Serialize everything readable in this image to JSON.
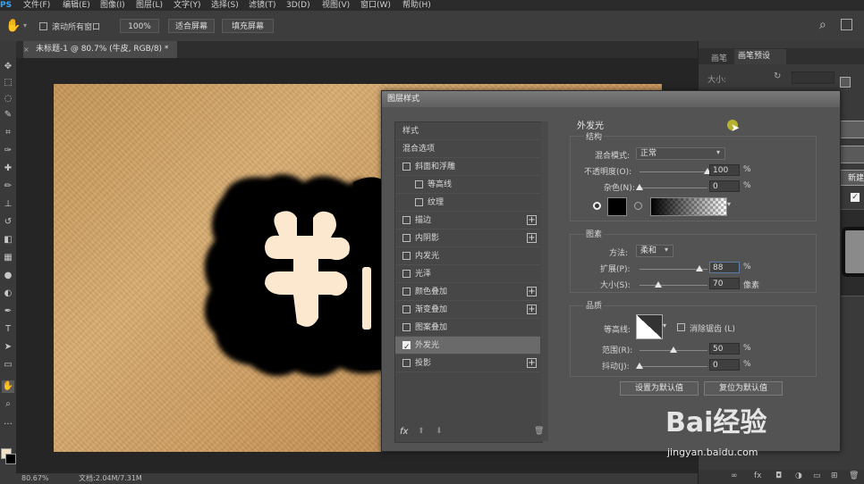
{
  "menu": {
    "app_badge": "PS",
    "items": [
      "文件(F)",
      "编辑(E)",
      "图像(I)",
      "图层(L)",
      "文字(Y)",
      "选择(S)",
      "滤镜(T)",
      "3D(D)",
      "视图(V)",
      "窗口(W)",
      "帮助(H)"
    ]
  },
  "options": {
    "scroll_all": "滚动所有窗口",
    "zoom": "100%",
    "fit_screen": "适合屏幕",
    "fill_screen": "填充屏幕"
  },
  "document": {
    "tab_title": "未标题-1 @ 80.7% (牛皮, RGB/8) *",
    "canvas_text": "朱"
  },
  "status": {
    "zoom": "80.67%",
    "doc_info": "文档:2.04M/7.31M"
  },
  "right_panel": {
    "tab1": "画笔",
    "tab2": "画笔预设",
    "size_label": "大小:"
  },
  "dialog": {
    "title": "图层样式",
    "side_items": [
      {
        "label": "样式",
        "cb": "none",
        "plus": false,
        "sel": false
      },
      {
        "label": "混合选项",
        "cb": "none",
        "plus": false,
        "sel": false
      },
      {
        "label": "斜面和浮雕",
        "cb": "off",
        "plus": false,
        "sel": false
      },
      {
        "label": "等高线",
        "cb": "off",
        "plus": false,
        "sel": false,
        "indent": true
      },
      {
        "label": "纹理",
        "cb": "off",
        "plus": false,
        "sel": false,
        "indent": true
      },
      {
        "label": "描边",
        "cb": "off",
        "plus": true,
        "sel": false
      },
      {
        "label": "内阴影",
        "cb": "off",
        "plus": true,
        "sel": false
      },
      {
        "label": "内发光",
        "cb": "off",
        "plus": false,
        "sel": false
      },
      {
        "label": "光泽",
        "cb": "off",
        "plus": false,
        "sel": false
      },
      {
        "label": "颜色叠加",
        "cb": "off",
        "plus": true,
        "sel": false
      },
      {
        "label": "渐变叠加",
        "cb": "off",
        "plus": true,
        "sel": false
      },
      {
        "label": "图案叠加",
        "cb": "off",
        "plus": false,
        "sel": false
      },
      {
        "label": "外发光",
        "cb": "on",
        "plus": false,
        "sel": true
      },
      {
        "label": "投影",
        "cb": "off",
        "plus": true,
        "sel": false
      }
    ],
    "fx_label": "fx",
    "heading": "外发光",
    "structure": {
      "title": "结构",
      "blend_mode_label": "混合模式:",
      "blend_mode": "正常",
      "opacity_label": "不透明度(O):",
      "opacity": "100",
      "opacity_pct": 1.0,
      "noise_label": "杂色(N):",
      "noise": "0",
      "noise_pct": 0.0,
      "unit": "%"
    },
    "elements": {
      "title": "图素",
      "method_label": "方法:",
      "method": "柔和",
      "spread_label": "扩展(P):",
      "spread": "88",
      "spread_pct": 0.88,
      "size_label": "大小(S):",
      "size": "70",
      "size_pct": 0.28,
      "pct_unit": "%",
      "px_unit": "像素"
    },
    "quality": {
      "title": "品质",
      "contour_label": "等高线:",
      "anti_alias": "消除锯齿 (L)",
      "range_label": "范围(R):",
      "range": "50",
      "range_pct": 0.5,
      "jitter_label": "抖动(J):",
      "jitter": "0",
      "jitter_pct": 0.0,
      "unit": "%"
    },
    "set_default": "设置为默认值",
    "reset_default": "复位为默认值",
    "new_button": "新建"
  },
  "watermark": {
    "logo": "Bai经验",
    "url": "jingyan.baidu.com"
  },
  "colors": {
    "leather": "#c9975a",
    "glow": "#000000",
    "text_fill": "#fbe8cf",
    "accent": "#31a8ff"
  }
}
